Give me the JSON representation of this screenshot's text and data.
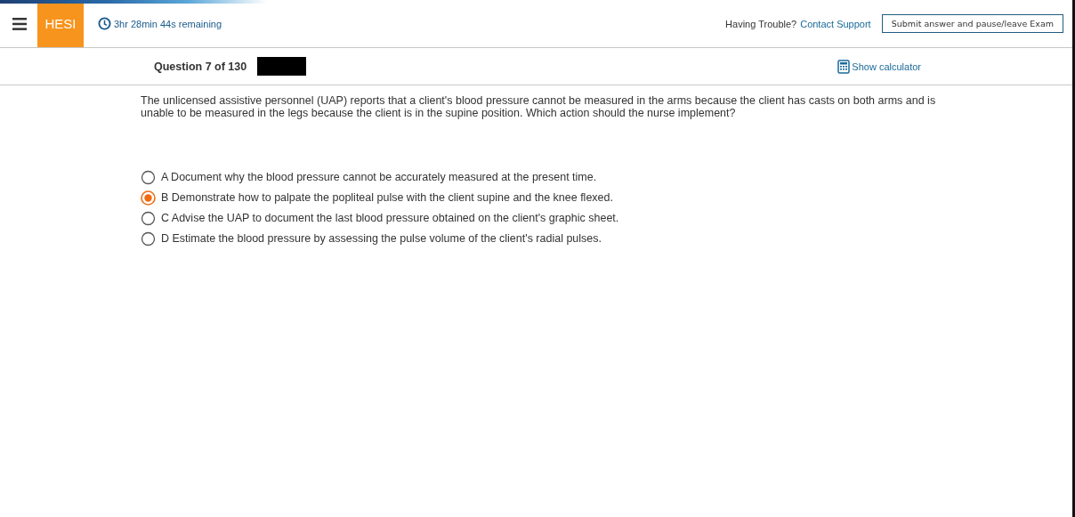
{
  "header": {
    "brand": "HESI",
    "timer": "3hr 28min 44s remaining",
    "help_text": "Having Trouble?",
    "support_link": "Contact Support",
    "submit_button": "Submit answer and pause/leave Exam"
  },
  "question_bar": {
    "counter": "Question 7 of 130",
    "calculator_link": "Show calculator"
  },
  "question": {
    "text": "The unlicensed assistive personnel (UAP) reports that a client's blood pressure cannot be measured in the arms because the client has casts on both arms and is unable to be measured in the legs because the client is in the supine position. Which action should the nurse implement?",
    "options": [
      {
        "text": "A Document why the blood pressure cannot be accurately measured at the present time.",
        "selected": false
      },
      {
        "text": "B Demonstrate how to palpate the popliteal pulse with the client supine and the knee flexed.",
        "selected": true
      },
      {
        "text": "C Advise the UAP to document the last blood pressure obtained on the client's graphic sheet.",
        "selected": false
      },
      {
        "text": "D Estimate the blood pressure by assessing the pulse volume of the client's radial pulses.",
        "selected": false
      }
    ]
  }
}
